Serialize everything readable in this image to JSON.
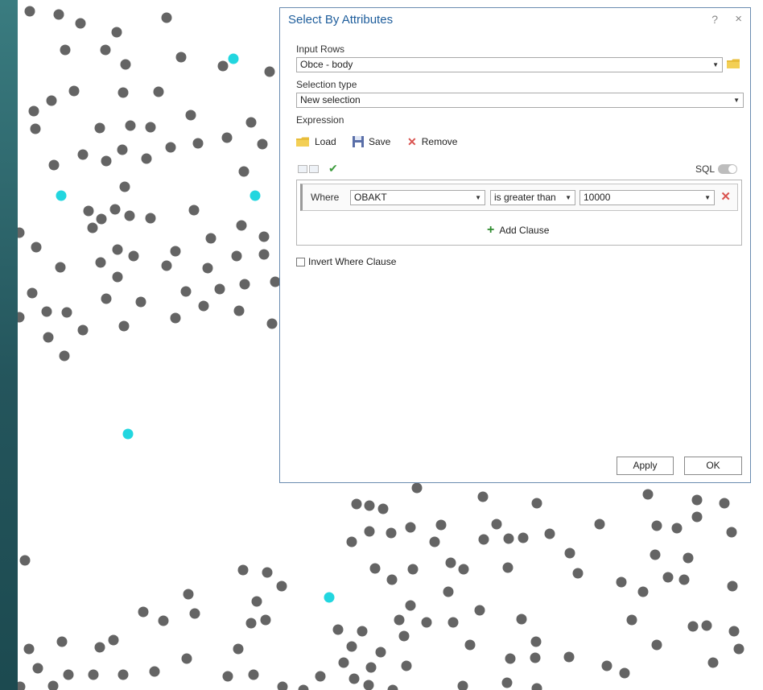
{
  "colors": {
    "point_default": "#646464",
    "point_selected": "#22d6df",
    "frame": "#2b5f66",
    "title": "#1f5e9c"
  },
  "dialog": {
    "title": "Select By Attributes",
    "help": "?",
    "close": "×",
    "input_rows_label": "Input Rows",
    "input_rows_value": "Obce - body",
    "selection_type_label": "Selection type",
    "selection_type_value": "New selection",
    "expression_label": "Expression",
    "load_label": "Load",
    "save_label": "Save",
    "remove_label": "Remove",
    "sql_label": "SQL",
    "clause": {
      "where_label": "Where",
      "field": "OBAKT",
      "operator": "is greater than",
      "value": "10000"
    },
    "add_clause_label": "Add Clause",
    "invert_label": "Invert Where Clause",
    "apply_label": "Apply",
    "ok_label": "OK"
  }
}
